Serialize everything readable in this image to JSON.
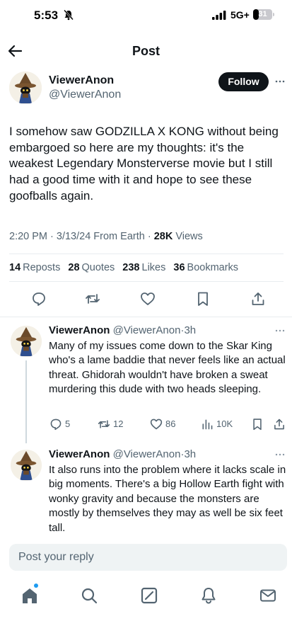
{
  "status_bar": {
    "time": "5:53",
    "network": "5G+",
    "battery": "31",
    "battery_level": 0.31
  },
  "header": {
    "title": "Post"
  },
  "post": {
    "author_name": "ViewerAnon",
    "author_handle": "@ViewerAnon",
    "follow_label": "Follow",
    "text": "I somehow saw GODZILLA X KONG without being embargoed so here are my thoughts: it's the weakest Legendary Monsterverse movie but I still had a good time with it and hope to see these goofballs again.",
    "timestamp": "2:20 PM · 3/13/24 From Earth · ",
    "views_count": "28K",
    "views_label": " Views",
    "stats": {
      "reposts_count": "14",
      "reposts_label": "Reposts",
      "quotes_count": "28",
      "quotes_label": "Quotes",
      "likes_count": "238",
      "likes_label": "Likes",
      "bookmarks_count": "36",
      "bookmarks_label": "Bookmarks"
    }
  },
  "replies": [
    {
      "author_name": "ViewerAnon",
      "author_handle": "@ViewerAnon",
      "time": "3h",
      "text": "Many of my issues come down to the Skar King who's a lame baddie that never feels like an actual threat. Ghidorah wouldn't have broken a sweat murdering this dude with two heads sleeping.",
      "replies_count": "5",
      "reposts_count": "12",
      "likes_count": "86",
      "views_count": "10K"
    },
    {
      "author_name": "ViewerAnon",
      "author_handle": "@ViewerAnon",
      "time": "3h",
      "text": "It also runs into the problem where it lacks scale in big moments. There's a big Hollow Earth fight with wonky gravity and because the monsters are mostly by themselves they may as well be six feet tall."
    }
  ],
  "composer": {
    "placeholder": "Post your reply"
  },
  "colors": {
    "text": "#0f1419",
    "secondary": "#536471",
    "accent": "#1d9bf0",
    "divider": "#e8ecef"
  },
  "icons": {
    "back": "arrow-left-icon",
    "reply": "speech-bubble-icon",
    "repost": "repost-arrows-icon",
    "like": "heart-icon",
    "bookmark": "bookmark-icon",
    "share": "share-icon",
    "views": "bar-chart-icon",
    "nav": [
      "home-icon",
      "search-icon",
      "grok-icon",
      "notifications-icon",
      "messages-icon"
    ]
  }
}
